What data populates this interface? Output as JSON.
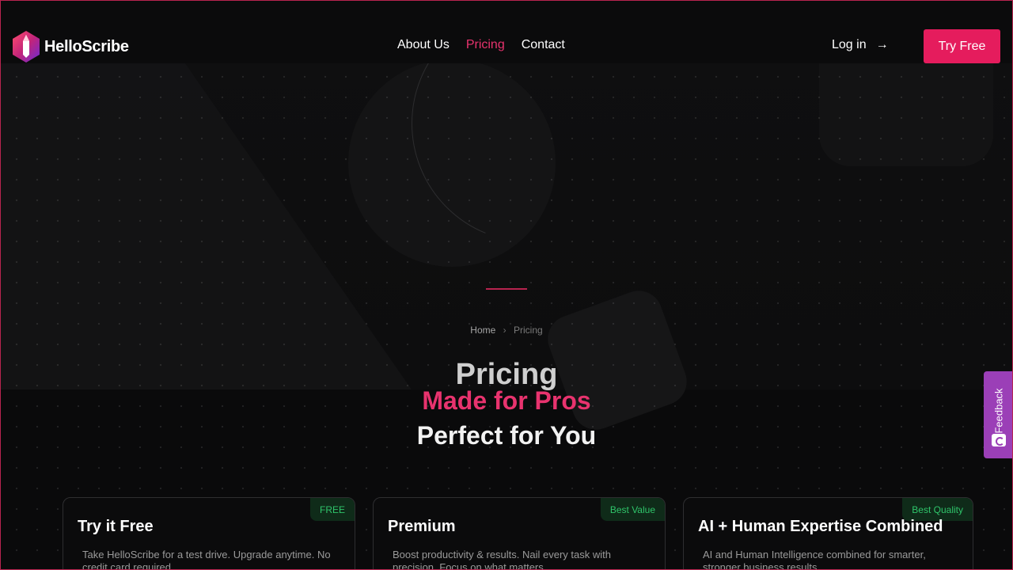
{
  "header": {
    "logo_text": "HelloScribe",
    "nav": [
      {
        "label": "About Us",
        "active": false
      },
      {
        "label": "Pricing",
        "active": true
      },
      {
        "label": "Contact",
        "active": false
      }
    ],
    "login_label": "Log in",
    "login_arrow": "→",
    "try_free_label": "Try Free"
  },
  "breadcrumb": {
    "home": "Home",
    "separator": "›",
    "current": "Pricing"
  },
  "hero": {
    "title_line1": "Pricing",
    "title_line2": "Made for Pros",
    "title_line3": "Perfect for You"
  },
  "plans": [
    {
      "badge": "FREE",
      "title": "Try it Free",
      "description": "Take HelloScribe for a test drive. Upgrade anytime. No credit card required."
    },
    {
      "badge": "Best Value",
      "title": "Premium",
      "description": "Boost productivity & results. Nail every task with precision. Focus on what matters."
    },
    {
      "badge": "Best Quality",
      "title": "AI  + Human Expertise Combined",
      "description": "AI and Human Intelligence combined for smarter, stronger business results."
    }
  ],
  "feedback": {
    "label": "Feedback",
    "icon": "feedback-icon"
  },
  "colors": {
    "accent": "#e51c5d",
    "accent_text": "#e8336e",
    "badge_bg": "#0f2b19",
    "badge_text": "#2fc46a",
    "feedback_bg": "#9b3fb7",
    "background": "#0a0a0b"
  }
}
